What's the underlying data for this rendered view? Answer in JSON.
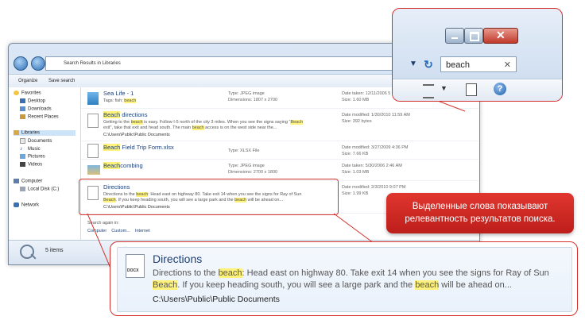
{
  "window": {
    "address": "Search Results in Libraries",
    "toolbar": {
      "organize": "Organize",
      "save_search": "Save search"
    }
  },
  "nav": {
    "items": [
      {
        "label": "Favorites"
      },
      {
        "label": "Desktop"
      },
      {
        "label": "Downloads"
      },
      {
        "label": "Recent Places"
      },
      {
        "label": "Libraries"
      },
      {
        "label": "Documents"
      },
      {
        "label": "Music"
      },
      {
        "label": "Pictures"
      },
      {
        "label": "Videos"
      },
      {
        "label": "Computer"
      },
      {
        "label": "Local Disk (C:)"
      },
      {
        "label": "Network"
      }
    ]
  },
  "results": [
    {
      "title": "Sea Life - 1",
      "snip1_pre": "Tags: fish; ",
      "snip1_hl": "beach",
      "type": "Type: JPEG image",
      "dims": "Dimensions: 1807 x 2700",
      "date": "Date taken: 12/11/2006 5",
      "size": "Size: 1.60 MB"
    },
    {
      "title_hl": "Beach",
      "title_post": " directions",
      "s1": "Getting to the ",
      "s1hl": "beach",
      "s1b": " is easy. Follow I-5 north of the city 3 miles. When you see the signs saying \"",
      "s1hl2": "Beach",
      "s1c": "",
      "s2": "exit\", take that exit and head south. The main ",
      "s2hl": "beach",
      "s2b": " access is on the west side near the...",
      "path": "C:\\Users\\Public\\Public Documents",
      "date": "Date modified: 1/30/2010 11:59 AM",
      "size": "Size: 392 bytes"
    },
    {
      "title_hl": "Beach",
      "title_post": " Field Trip Form.xlsx",
      "type": "Type: XLSX File",
      "date": "Date modified: 3/27/2009 4:36 PM",
      "size": "Size: 7.66 KB"
    },
    {
      "title_hl": "Beach",
      "title_post": "combing",
      "type": "Type: JPEG image",
      "dims": "Dimensions: 2700 x 1800",
      "date": "Date taken: 5/30/2006 2:46 AM",
      "size": "Size: 1.03 MB"
    },
    {
      "title": "Directions",
      "s1": "Directions to the ",
      "s1hl": "beach",
      "s1b": ": Head east on highway 80. Take exit 14 when you see the signs for Ray of Sun",
      "s2hl": "Beach",
      "s2": ". If you keep heading south, you will see a large park and the ",
      "s2hl2": "beach",
      "s2b": " will be ahead on...",
      "path": "C:\\Users\\Public\\Public Documents",
      "date": "Date modified: 2/3/2010 9:07 PM",
      "size": "Size: 1.99 KB"
    }
  ],
  "search_again": {
    "label": "Search again in:",
    "options": [
      "Computer",
      "Custom...",
      "Internet"
    ]
  },
  "status": {
    "count": "5 items"
  },
  "zoom": {
    "search_value": "beach"
  },
  "callout": {
    "line1": "Выделенные слова показывают",
    "line2": "релевантность результатов поиска."
  },
  "big_result": {
    "title": "Directions",
    "icon_label": "DOCX",
    "l1a": "Directions to the ",
    "l1hl": "beach",
    "l1b": ": Head east on highway 80. Take exit 14 when you see the signs for Ray of Sun",
    "l2hl": "Beach",
    "l2a": ". If you keep heading south, you will see a large park and the ",
    "l2hl2": "beach",
    "l2b": " will be ahead on...",
    "path": "C:\\Users\\Public\\Public Documents"
  },
  "colors": {
    "highlight": "#fff27a",
    "callout_red": "#d4302c",
    "link_blue": "#1d3f73"
  }
}
